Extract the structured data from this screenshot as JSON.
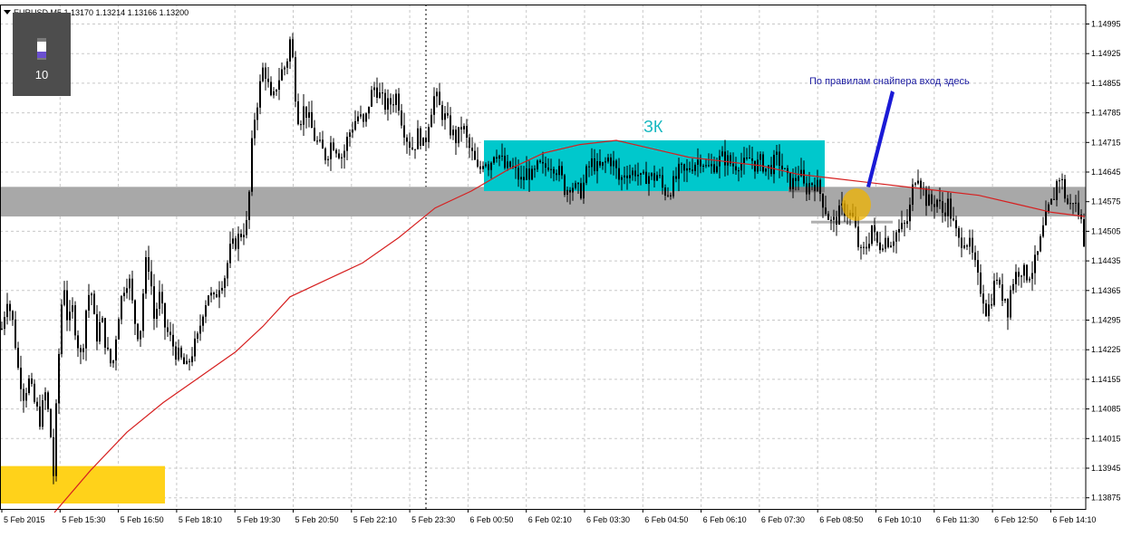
{
  "header": {
    "symbol_line": "EURUSD,M5  1.13170 1.13214 1.13166 1.13200"
  },
  "widget": {
    "value": "10"
  },
  "annotations": {
    "zone_label": "ЗК",
    "note": "По правилам снайпера вход здесь"
  },
  "colors": {
    "candle": "#000000",
    "ma": "#d62020",
    "cyan_zone": "#00c8cc",
    "gray_band": "#a8a8a8",
    "yellow_box": "#ffd21a",
    "arrow": "#1a1ad6",
    "grid": "#c8c8c8",
    "note_text": "#1a1aa0",
    "zone_text": "#16b8c0"
  },
  "chart_data": {
    "type": "candlestick",
    "symbol": "EURUSD",
    "timeframe": "M5",
    "ylim": [
      1.1384,
      1.1505
    ],
    "y_ticks": [
      "1.14995",
      "1.14925",
      "1.14855",
      "1.14785",
      "1.14715",
      "1.14645",
      "1.14575",
      "1.14505",
      "1.14435",
      "1.14365",
      "1.14295",
      "1.14225",
      "1.14155",
      "1.14085",
      "1.14015",
      "1.13945",
      "1.13875"
    ],
    "x_ticks": [
      "5 Feb 2015",
      "5 Feb 15:30",
      "5 Feb 16:50",
      "5 Feb 18:10",
      "5 Feb 19:30",
      "5 Feb 20:50",
      "5 Feb 22:10",
      "5 Feb 23:30",
      "6 Feb 00:50",
      "6 Feb 02:10",
      "6 Feb 03:30",
      "6 Feb 04:50",
      "6 Feb 06:10",
      "6 Feb 07:30",
      "6 Feb 08:50",
      "6 Feb 10:10",
      "6 Feb 11:30",
      "6 Feb 12:50",
      "6 Feb 14:10"
    ],
    "grid": true,
    "close_path": [
      [
        0,
        1.1425
      ],
      [
        8,
        1.1435
      ],
      [
        15,
        1.1428
      ],
      [
        20,
        1.1418
      ],
      [
        26,
        1.1412
      ],
      [
        32,
        1.1415
      ],
      [
        38,
        1.141
      ],
      [
        44,
        1.1406
      ],
      [
        50,
        1.1412
      ],
      [
        55,
        1.1405
      ],
      [
        59,
        1.1393
      ],
      [
        63,
        1.1413
      ],
      [
        67,
        1.143
      ],
      [
        70,
        1.144
      ],
      [
        75,
        1.1428
      ],
      [
        80,
        1.1432
      ],
      [
        85,
        1.1425
      ],
      [
        90,
        1.142
      ],
      [
        95,
        1.1432
      ],
      [
        100,
        1.1438
      ],
      [
        106,
        1.1425
      ],
      [
        112,
        1.143
      ],
      [
        118,
        1.1422
      ],
      [
        124,
        1.1418
      ],
      [
        130,
        1.143
      ],
      [
        136,
        1.1437
      ],
      [
        142,
        1.144
      ],
      [
        148,
        1.143
      ],
      [
        154,
        1.1425
      ],
      [
        158,
        1.1436
      ],
      [
        162,
        1.1445
      ],
      [
        166,
        1.144
      ],
      [
        170,
        1.143
      ],
      [
        176,
        1.1435
      ],
      [
        182,
        1.1428
      ],
      [
        188,
        1.1425
      ],
      [
        194,
        1.1422
      ],
      [
        200,
        1.142
      ],
      [
        206,
        1.1418
      ],
      [
        212,
        1.1422
      ],
      [
        218,
        1.1425
      ],
      [
        224,
        1.1432
      ],
      [
        230,
        1.1436
      ],
      [
        236,
        1.1434
      ],
      [
        242,
        1.1438
      ],
      [
        248,
        1.144
      ],
      [
        254,
        1.1446
      ],
      [
        260,
        1.1448
      ],
      [
        266,
        1.145
      ],
      [
        272,
        1.1452
      ],
      [
        276,
        1.1462
      ],
      [
        279,
        1.1475
      ],
      [
        283,
        1.148
      ],
      [
        287,
        1.1485
      ],
      [
        291,
        1.149
      ],
      [
        295,
        1.1486
      ],
      [
        300,
        1.148
      ],
      [
        305,
        1.1485
      ],
      [
        310,
        1.1488
      ],
      [
        316,
        1.149
      ],
      [
        321,
        1.1497
      ],
      [
        325,
        1.1485
      ],
      [
        330,
        1.1476
      ],
      [
        336,
        1.148
      ],
      [
        342,
        1.1476
      ],
      [
        348,
        1.1472
      ],
      [
        354,
        1.147
      ],
      [
        360,
        1.1468
      ],
      [
        366,
        1.1472
      ],
      [
        372,
        1.147
      ],
      [
        378,
        1.1468
      ],
      [
        384,
        1.1473
      ],
      [
        390,
        1.1476
      ],
      [
        396,
        1.1478
      ],
      [
        402,
        1.1475
      ],
      [
        408,
        1.1482
      ],
      [
        414,
        1.1485
      ],
      [
        420,
        1.1482
      ],
      [
        426,
        1.148
      ],
      [
        432,
        1.1481
      ],
      [
        438,
        1.1483
      ],
      [
        444,
        1.1476
      ],
      [
        450,
        1.1472
      ],
      [
        456,
        1.147
      ],
      [
        462,
        1.1474
      ],
      [
        468,
        1.147
      ],
      [
        474,
        1.1478
      ],
      [
        480,
        1.1483
      ],
      [
        486,
        1.1479
      ],
      [
        492,
        1.1477
      ],
      [
        498,
        1.1474
      ],
      [
        504,
        1.1472
      ],
      [
        510,
        1.1476
      ],
      [
        516,
        1.1471
      ],
      [
        522,
        1.1468
      ],
      [
        528,
        1.1464
      ],
      [
        534,
        1.1468
      ],
      [
        540,
        1.1466
      ],
      [
        546,
        1.147
      ],
      [
        552,
        1.1468
      ],
      [
        558,
        1.1465
      ],
      [
        564,
        1.1466
      ],
      [
        570,
        1.1464
      ],
      [
        576,
        1.1462
      ],
      [
        582,
        1.1465
      ],
      [
        588,
        1.1463
      ],
      [
        594,
        1.1466
      ],
      [
        600,
        1.1465
      ],
      [
        606,
        1.1467
      ],
      [
        612,
        1.1466
      ],
      [
        618,
        1.1464
      ],
      [
        624,
        1.146
      ],
      [
        630,
        1.1462
      ],
      [
        636,
        1.146
      ],
      [
        642,
        1.146
      ],
      [
        648,
        1.1465
      ],
      [
        654,
        1.1467
      ],
      [
        660,
        1.1465
      ],
      [
        666,
        1.1466
      ],
      [
        672,
        1.1468
      ],
      [
        678,
        1.1466
      ],
      [
        684,
        1.1462
      ],
      [
        690,
        1.1465
      ],
      [
        696,
        1.1464
      ],
      [
        702,
        1.1465
      ],
      [
        708,
        1.1462
      ],
      [
        714,
        1.1464
      ],
      [
        720,
        1.1463
      ],
      [
        726,
        1.1464
      ],
      [
        732,
        1.146
      ],
      [
        738,
        1.146
      ],
      [
        744,
        1.1462
      ],
      [
        750,
        1.1465
      ],
      [
        756,
        1.1464
      ],
      [
        762,
        1.1466
      ],
      [
        768,
        1.1467
      ],
      [
        774,
        1.1468
      ],
      [
        780,
        1.1465
      ],
      [
        786,
        1.1466
      ],
      [
        792,
        1.1467
      ],
      [
        798,
        1.1468
      ],
      [
        804,
        1.1467
      ],
      [
        810,
        1.1466
      ],
      [
        816,
        1.1467
      ],
      [
        822,
        1.1466
      ],
      [
        828,
        1.1468
      ],
      [
        834,
        1.1466
      ],
      [
        840,
        1.1467
      ],
      [
        846,
        1.1465
      ],
      [
        852,
        1.1466
      ],
      [
        858,
        1.1468
      ],
      [
        864,
        1.1465
      ],
      [
        870,
        1.1462
      ],
      [
        876,
        1.1462
      ],
      [
        882,
        1.1465
      ],
      [
        888,
        1.146
      ],
      [
        894,
        1.1462
      ],
      [
        900,
        1.1462
      ],
      [
        906,
        1.1459
      ],
      [
        912,
        1.1455
      ],
      [
        918,
        1.1452
      ],
      [
        924,
        1.1454
      ],
      [
        930,
        1.1456
      ],
      [
        936,
        1.1455
      ],
      [
        942,
        1.1453
      ],
      [
        946,
        1.1448
      ],
      [
        950,
        1.1445
      ],
      [
        954,
        1.1446
      ],
      [
        958,
        1.1448
      ],
      [
        962,
        1.1452
      ],
      [
        966,
        1.1448
      ],
      [
        970,
        1.1447
      ],
      [
        976,
        1.1449
      ],
      [
        982,
        1.1448
      ],
      [
        988,
        1.145
      ],
      [
        994,
        1.1451
      ],
      [
        1000,
        1.1452
      ],
      [
        1004,
        1.1456
      ],
      [
        1008,
        1.1462
      ],
      [
        1012,
        1.1465
      ],
      [
        1016,
        1.1462
      ],
      [
        1022,
        1.1458
      ],
      [
        1028,
        1.1457
      ],
      [
        1034,
        1.1458
      ],
      [
        1040,
        1.1455
      ],
      [
        1046,
        1.1457
      ],
      [
        1052,
        1.1452
      ],
      [
        1058,
        1.1448
      ],
      [
        1064,
        1.1449
      ],
      [
        1070,
        1.1447
      ],
      [
        1076,
        1.1442
      ],
      [
        1080,
        1.1438
      ],
      [
        1084,
        1.1436
      ],
      [
        1088,
        1.1432
      ],
      [
        1092,
        1.1433
      ],
      [
        1096,
        1.1437
      ],
      [
        1100,
        1.144
      ],
      [
        1104,
        1.1435
      ],
      [
        1108,
        1.1436
      ],
      [
        1112,
        1.1432
      ],
      [
        1116,
        1.1438
      ],
      [
        1120,
        1.144
      ],
      [
        1126,
        1.1442
      ],
      [
        1132,
        1.144
      ],
      [
        1138,
        1.1441
      ],
      [
        1144,
        1.1444
      ],
      [
        1150,
        1.145
      ],
      [
        1156,
        1.1455
      ],
      [
        1162,
        1.1458
      ],
      [
        1168,
        1.1464
      ],
      [
        1172,
        1.1462
      ],
      [
        1176,
        1.1458
      ],
      [
        1180,
        1.1456
      ],
      [
        1184,
        1.1458
      ],
      [
        1188,
        1.1456
      ],
      [
        1192,
        1.1454
      ],
      [
        1197,
        1.1447
      ]
    ],
    "ma_path": [
      [
        60,
        1.1384
      ],
      [
        100,
        1.1394
      ],
      [
        140,
        1.1403
      ],
      [
        180,
        1.141
      ],
      [
        220,
        1.1416
      ],
      [
        260,
        1.1422
      ],
      [
        290,
        1.1428
      ],
      [
        320,
        1.1435
      ],
      [
        360,
        1.1439
      ],
      [
        400,
        1.1443
      ],
      [
        440,
        1.1449
      ],
      [
        480,
        1.1456
      ],
      [
        520,
        1.146
      ],
      [
        560,
        1.1465
      ],
      [
        600,
        1.1469
      ],
      [
        640,
        1.1471
      ],
      [
        680,
        1.1472
      ],
      [
        720,
        1.147
      ],
      [
        760,
        1.1468
      ],
      [
        800,
        1.1467
      ],
      [
        840,
        1.1466
      ],
      [
        880,
        1.1464
      ],
      [
        920,
        1.1463
      ],
      [
        960,
        1.1462
      ],
      [
        1000,
        1.1461
      ],
      [
        1040,
        1.146
      ],
      [
        1080,
        1.1459
      ],
      [
        1120,
        1.1457
      ],
      [
        1160,
        1.1455
      ],
      [
        1197,
        1.1454
      ]
    ],
    "zones": [
      {
        "name": "cyan_box",
        "price_from": 1.146,
        "price_to": 1.1472
      },
      {
        "name": "gray_band",
        "price_from": 1.1454,
        "price_to": 1.1461
      },
      {
        "name": "yellow_box",
        "price_from": 1.1384,
        "price_to": 1.1395
      }
    ]
  }
}
